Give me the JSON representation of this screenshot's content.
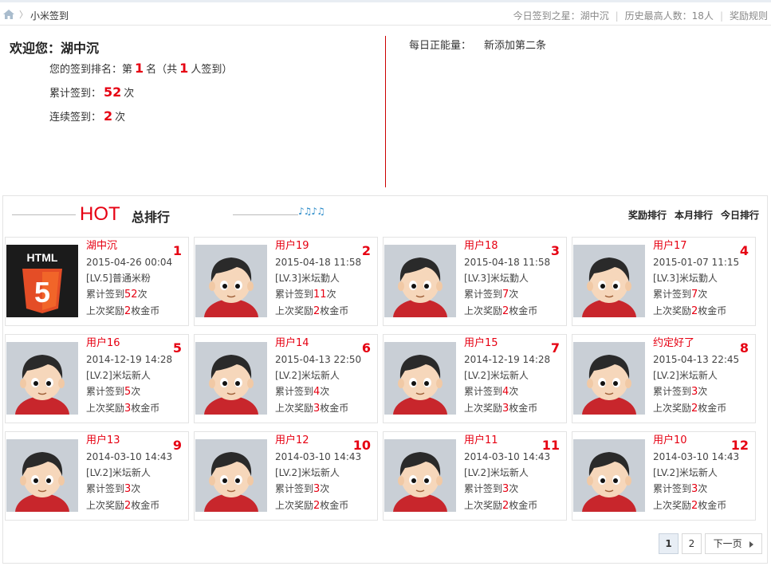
{
  "breadcrumb": {
    "current": "小米签到"
  },
  "top_links": {
    "star": "今日签到之星：湖中沉",
    "record": "历史最高人数：18人",
    "rules": "奖励规则"
  },
  "welcome": {
    "greeting": "欢迎您：湖中沉",
    "rank_prefix": "您的签到排名：第",
    "rank_value": "1",
    "rank_mid": "名（共",
    "rank_total": "1",
    "rank_suffix": "人签到）",
    "total_prefix": "累计签到：",
    "total_value": "52",
    "total_suffix": "次",
    "streak_prefix": "连续签到：",
    "streak_value": "2",
    "streak_suffix": "次"
  },
  "energy": {
    "label": "每日正能量：",
    "text": "新添加第二条"
  },
  "ranking": {
    "hot": "HOT",
    "title": "总排行",
    "music": "♪♫♪♫",
    "tabs": [
      "奖励排行",
      "本月排行",
      "今日排行"
    ]
  },
  "cards": [
    {
      "name": "湖中沉",
      "date": "2015-04-26 00:04",
      "level": "[LV.5]普通米粉",
      "total_prefix": "累计签到",
      "total": "52",
      "unit": "次",
      "reward_prefix": "上次奖励",
      "reward": "2",
      "reward_unit": "枚金币",
      "rank": "1",
      "avatar": "html5",
      "avatar_text": "HTML",
      "avatar_digit": "5"
    },
    {
      "name": "用户19",
      "date": "2015-04-18 11:58",
      "level": "[LV.3]米坛勤人",
      "total_prefix": "累计签到",
      "total": "11",
      "unit": "次",
      "reward_prefix": "上次奖励",
      "reward": "2",
      "reward_unit": "枚金币",
      "rank": "2",
      "avatar": "default"
    },
    {
      "name": "用户18",
      "date": "2015-04-18 11:58",
      "level": "[LV.3]米坛勤人",
      "total_prefix": "累计签到",
      "total": "7",
      "unit": "次",
      "reward_prefix": "上次奖励",
      "reward": "2",
      "reward_unit": "枚金币",
      "rank": "3",
      "avatar": "default"
    },
    {
      "name": "用户17",
      "date": "2015-01-07 11:15",
      "level": "[LV.3]米坛勤人",
      "total_prefix": "累计签到",
      "total": "7",
      "unit": "次",
      "reward_prefix": "上次奖励",
      "reward": "2",
      "reward_unit": "枚金币",
      "rank": "4",
      "avatar": "default"
    },
    {
      "name": "用户16",
      "date": "2014-12-19 14:28",
      "level": "[LV.2]米坛新人",
      "total_prefix": "累计签到",
      "total": "5",
      "unit": "次",
      "reward_prefix": "上次奖励",
      "reward": "3",
      "reward_unit": "枚金币",
      "rank": "5",
      "avatar": "default"
    },
    {
      "name": "用户14",
      "date": "2015-04-13 22:50",
      "level": "[LV.2]米坛新人",
      "total_prefix": "累计签到",
      "total": "4",
      "unit": "次",
      "reward_prefix": "上次奖励",
      "reward": "3",
      "reward_unit": "枚金币",
      "rank": "6",
      "avatar": "default"
    },
    {
      "name": "用户15",
      "date": "2014-12-19 14:28",
      "level": "[LV.2]米坛新人",
      "total_prefix": "累计签到",
      "total": "4",
      "unit": "次",
      "reward_prefix": "上次奖励",
      "reward": "3",
      "reward_unit": "枚金币",
      "rank": "7",
      "avatar": "default"
    },
    {
      "name": "约定好了",
      "date": "2015-04-13 22:45",
      "level": "[LV.2]米坛新人",
      "total_prefix": "累计签到",
      "total": "3",
      "unit": "次",
      "reward_prefix": "上次奖励",
      "reward": "2",
      "reward_unit": "枚金币",
      "rank": "8",
      "avatar": "default"
    },
    {
      "name": "用户13",
      "date": "2014-03-10 14:43",
      "level": "[LV.2]米坛新人",
      "total_prefix": "累计签到",
      "total": "3",
      "unit": "次",
      "reward_prefix": "上次奖励",
      "reward": "2",
      "reward_unit": "枚金币",
      "rank": "9",
      "avatar": "default"
    },
    {
      "name": "用户12",
      "date": "2014-03-10 14:43",
      "level": "[LV.2]米坛新人",
      "total_prefix": "累计签到",
      "total": "3",
      "unit": "次",
      "reward_prefix": "上次奖励",
      "reward": "2",
      "reward_unit": "枚金币",
      "rank": "10",
      "avatar": "default"
    },
    {
      "name": "用户11",
      "date": "2014-03-10 14:43",
      "level": "[LV.2]米坛新人",
      "total_prefix": "累计签到",
      "total": "3",
      "unit": "次",
      "reward_prefix": "上次奖励",
      "reward": "2",
      "reward_unit": "枚金币",
      "rank": "11",
      "avatar": "default"
    },
    {
      "name": "用户10",
      "date": "2014-03-10 14:43",
      "level": "[LV.2]米坛新人",
      "total_prefix": "累计签到",
      "total": "3",
      "unit": "次",
      "reward_prefix": "上次奖励",
      "reward": "2",
      "reward_unit": "枚金币",
      "rank": "12",
      "avatar": "default"
    }
  ],
  "pager": {
    "pages": [
      "1",
      "2"
    ],
    "current": "1",
    "next": "下一页"
  },
  "colors": {
    "accent": "#e60012",
    "divider": "#cc0000"
  }
}
